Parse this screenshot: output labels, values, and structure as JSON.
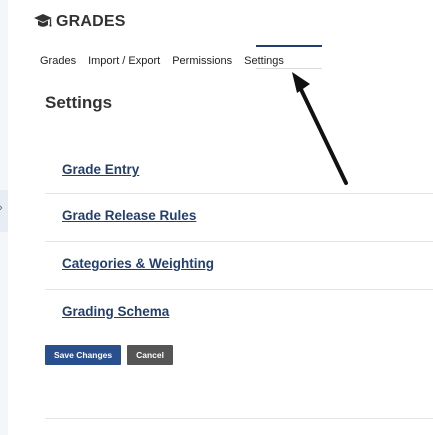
{
  "tool": {
    "title": "GRADES",
    "icon": "graduation-cap-icon"
  },
  "tabs": [
    {
      "label": "Grades",
      "active": false
    },
    {
      "label": "Import / Export",
      "active": false
    },
    {
      "label": "Permissions",
      "active": false
    },
    {
      "label": "Settings",
      "active": true
    }
  ],
  "page": {
    "heading": "Settings"
  },
  "settings_items": [
    {
      "label": "Grade Entry"
    },
    {
      "label": "Grade Release Rules"
    },
    {
      "label": "Categories & Weighting"
    },
    {
      "label": "Grading Schema"
    }
  ],
  "buttons": {
    "save_label": "Save Changes",
    "cancel_label": "Cancel"
  },
  "sidebar": {
    "collapse_icon": "chevron-right-icon"
  },
  "annotation": {
    "icon": "arrow-annotation-icon",
    "color": "#111111"
  },
  "colors": {
    "primary": "#2a4f8e",
    "link": "#233f6e",
    "secondary_button": "#555555"
  }
}
